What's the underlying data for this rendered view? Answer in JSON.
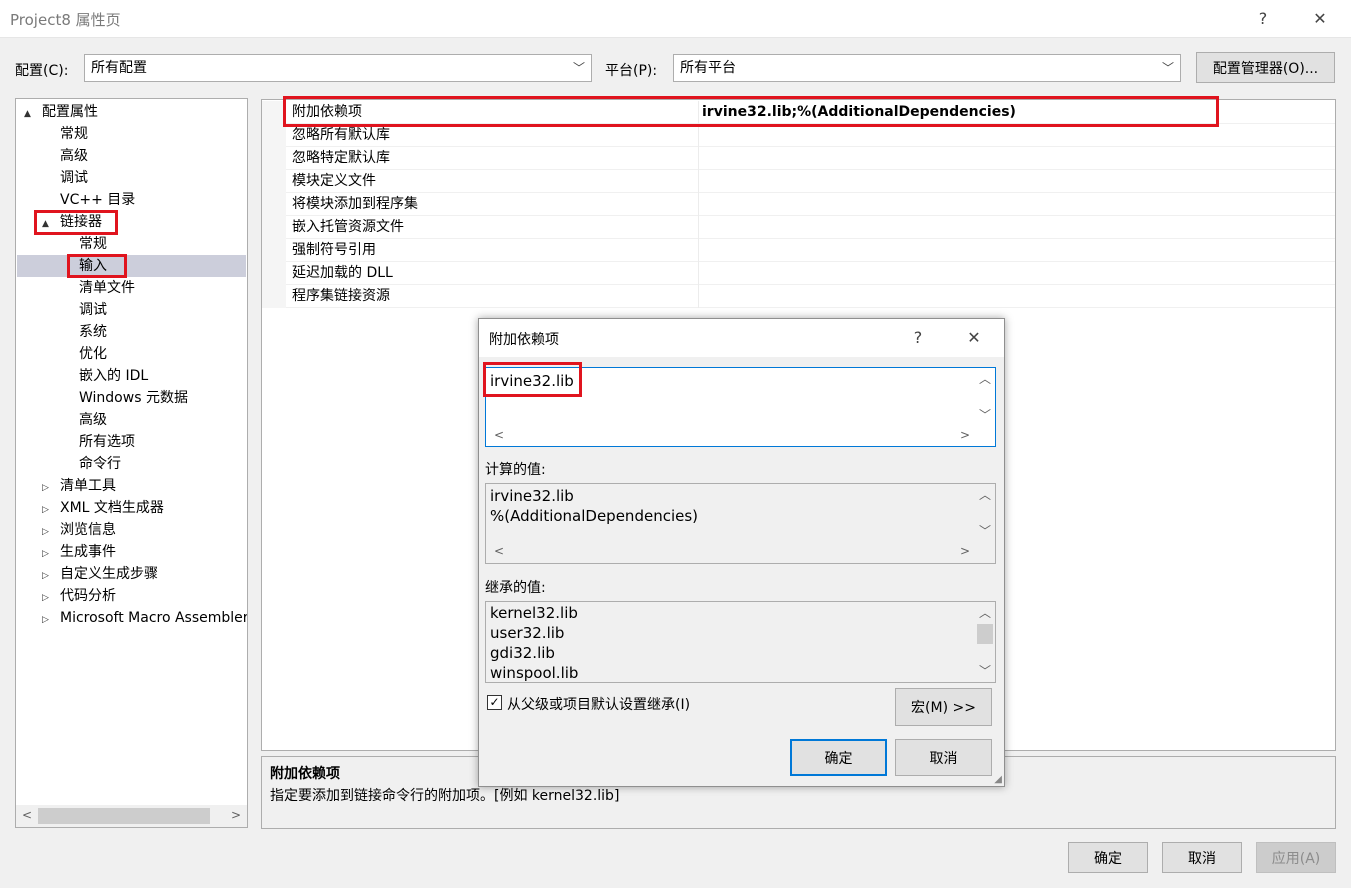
{
  "window": {
    "title": "Project8 属性页",
    "help": "?",
    "close": "✕"
  },
  "toolbar": {
    "config_label": "配置(C):",
    "config_value": "所有配置",
    "platform_label": "平台(P):",
    "platform_value": "所有平台",
    "config_manager": "配置管理器(O)..."
  },
  "tree": {
    "root": "配置属性",
    "items": [
      "常规",
      "高级",
      "调试",
      "VC++ 目录"
    ],
    "linker": "链接器",
    "linker_items": [
      "常规",
      "输入",
      "清单文件",
      "调试",
      "系统",
      "优化",
      "嵌入的 IDL",
      "Windows 元数据",
      "高级",
      "所有选项",
      "命令行"
    ],
    "collapsed": [
      "清单工具",
      "XML 文档生成器",
      "浏览信息",
      "生成事件",
      "自定义生成步骤",
      "代码分析",
      "Microsoft Macro Assembler"
    ],
    "selected": "输入"
  },
  "grid": {
    "rows": [
      {
        "name": "附加依赖项",
        "value": "irvine32.lib;%(AdditionalDependencies)"
      },
      {
        "name": "忽略所有默认库",
        "value": ""
      },
      {
        "name": "忽略特定默认库",
        "value": ""
      },
      {
        "name": "模块定义文件",
        "value": ""
      },
      {
        "name": "将模块添加到程序集",
        "value": ""
      },
      {
        "name": "嵌入托管资源文件",
        "value": ""
      },
      {
        "name": "强制符号引用",
        "value": ""
      },
      {
        "name": "延迟加载的 DLL",
        "value": ""
      },
      {
        "name": "程序集链接资源",
        "value": ""
      }
    ]
  },
  "description": {
    "title": "附加依赖项",
    "text": "指定要添加到链接命令行的附加项。[例如 kernel32.lib]"
  },
  "dialog": {
    "title": "附加依赖项",
    "help": "?",
    "close": "✕",
    "edit_value": "irvine32.lib",
    "computed_label": "计算的值:",
    "computed": [
      "irvine32.lib",
      "%(AdditionalDependencies)"
    ],
    "inherited_label": "继承的值:",
    "inherited": [
      "kernel32.lib",
      "user32.lib",
      "gdi32.lib",
      "winspool.lib"
    ],
    "inherit_check": "从父级或项目默认设置继承(I)",
    "inherit_checked": true,
    "macro_button": "宏(M) >>",
    "ok": "确定",
    "cancel": "取消"
  },
  "footer": {
    "ok": "确定",
    "cancel": "取消",
    "apply": "应用(A)"
  },
  "icons": {
    "expanded": "▲",
    "collapsed": "▷",
    "check": "✓",
    "dropdown": "chevron-down-icon"
  }
}
